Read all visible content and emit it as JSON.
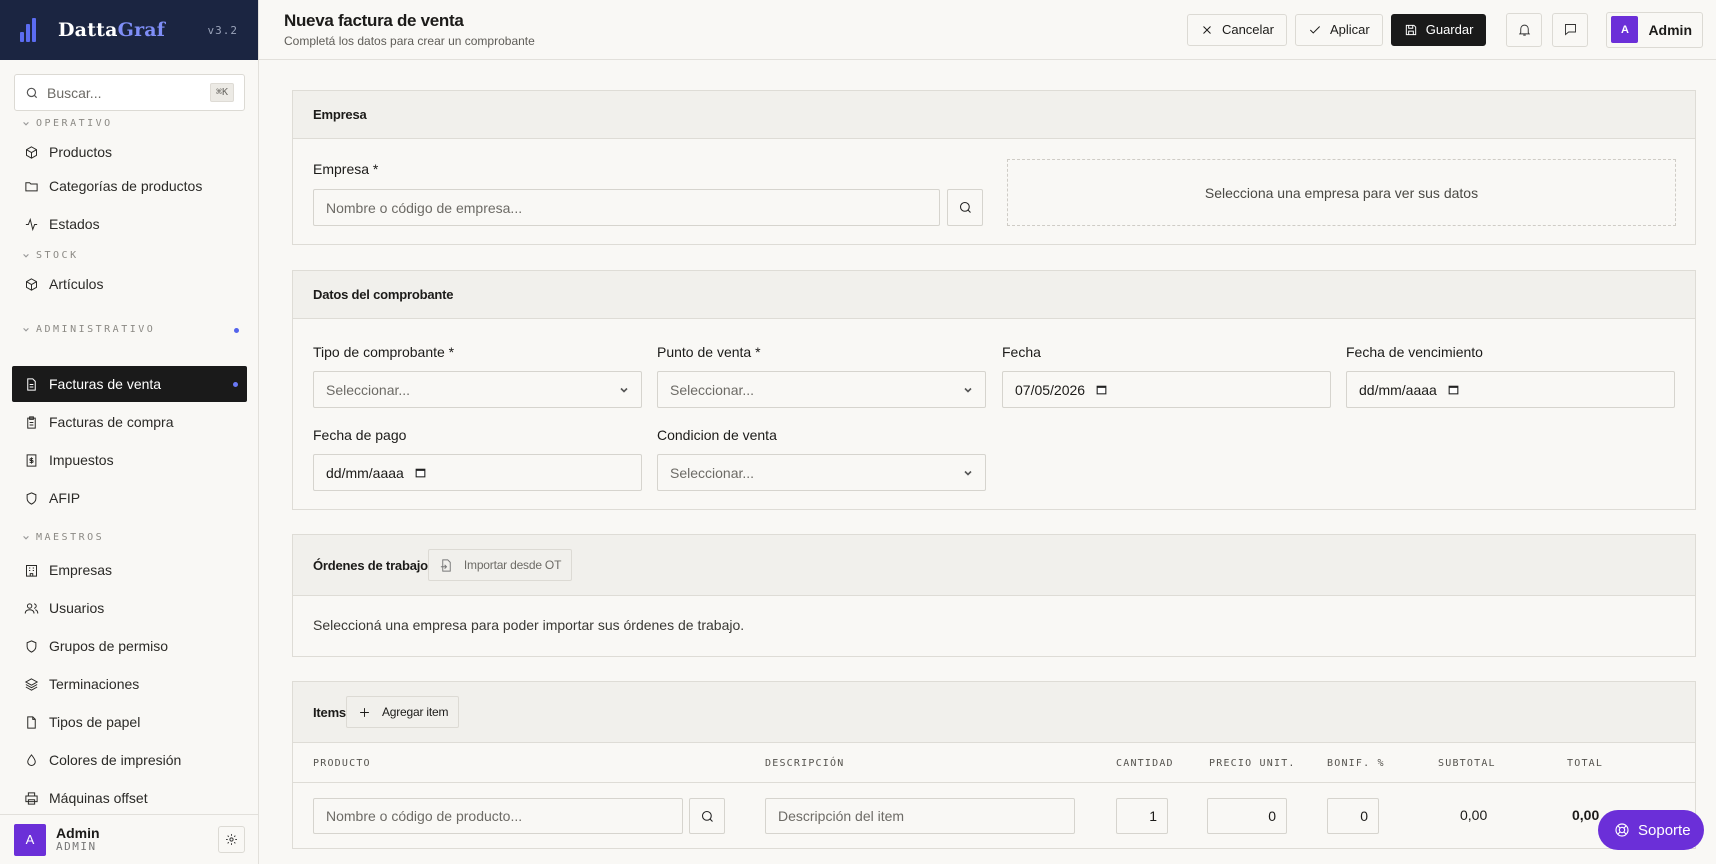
{
  "brand": {
    "name_a": "Datta",
    "name_b": "Graf",
    "version": "v3.2"
  },
  "search": {
    "placeholder": "Buscar...",
    "shortcut": "⌘K"
  },
  "nav": {
    "sections": [
      {
        "label": "OPERATIVO"
      },
      {
        "label": "STOCK"
      },
      {
        "label": "ADMINISTRATIVO"
      },
      {
        "label": "MAESTROS"
      }
    ],
    "items": [
      {
        "label": "Productos",
        "icon": "box-icon"
      },
      {
        "label": "Categorías de productos",
        "icon": "folder-icon"
      },
      {
        "label": "Estados",
        "icon": "activity-icon"
      },
      {
        "label": "Artículos",
        "icon": "box-icon"
      },
      {
        "label": "Facturas de venta",
        "icon": "file-icon",
        "active": true
      },
      {
        "label": "Facturas de compra",
        "icon": "clipboard-icon"
      },
      {
        "label": "Impuestos",
        "icon": "receipt-icon"
      },
      {
        "label": "AFIP",
        "icon": "shield-icon"
      },
      {
        "label": "Empresas",
        "icon": "building-icon"
      },
      {
        "label": "Usuarios",
        "icon": "users-icon"
      },
      {
        "label": "Grupos de permiso",
        "icon": "shield-icon"
      },
      {
        "label": "Terminaciones",
        "icon": "layers-icon"
      },
      {
        "label": "Tipos de papel",
        "icon": "file-icon"
      },
      {
        "label": "Colores de impresión",
        "icon": "droplet-icon"
      },
      {
        "label": "Máquinas offset",
        "icon": "printer-icon"
      }
    ]
  },
  "user": {
    "initial": "A",
    "name": "Admin",
    "role": "ADMIN"
  },
  "header": {
    "title": "Nueva factura de venta",
    "subtitle": "Completá los datos para crear un comprobante",
    "cancel": "Cancelar",
    "apply": "Aplicar",
    "save": "Guardar"
  },
  "empresa": {
    "title": "Empresa",
    "label": "Empresa *",
    "placeholder": "Nombre o código de empresa...",
    "empty": "Selecciona una empresa para ver sus datos"
  },
  "comprobante": {
    "title": "Datos del comprobante",
    "tipo_label": "Tipo de comprobante *",
    "tipo_value": "Seleccionar...",
    "punto_label": "Punto de venta *",
    "punto_value": "Seleccionar...",
    "fecha_label": "Fecha",
    "fecha_value": "07/05/2026",
    "venc_label": "Fecha de vencimiento",
    "venc_value": "dd/mm/aaaa",
    "pago_label": "Fecha de pago",
    "pago_value": "dd/mm/aaaa",
    "cond_label": "Condicion de venta",
    "cond_value": "Seleccionar..."
  },
  "ordenes": {
    "title": "Órdenes de trabajo",
    "import": "Importar desde OT",
    "empty": "Seleccioná una empresa para poder importar sus órdenes de trabajo."
  },
  "items": {
    "title": "Items",
    "add": "Agregar item",
    "columns": [
      "PRODUCTO",
      "DESCRIPCIÓN",
      "CANTIDAD",
      "PRECIO UNIT.",
      "BONIF. %",
      "SUBTOTAL",
      "TOTAL"
    ],
    "row": {
      "product_placeholder": "Nombre o código de producto...",
      "desc_placeholder": "Descripción del item",
      "cantidad": "1",
      "precio": "0",
      "bonif": "0",
      "subtotal": "0,00",
      "total": "0,00"
    }
  },
  "support": "Soporte"
}
